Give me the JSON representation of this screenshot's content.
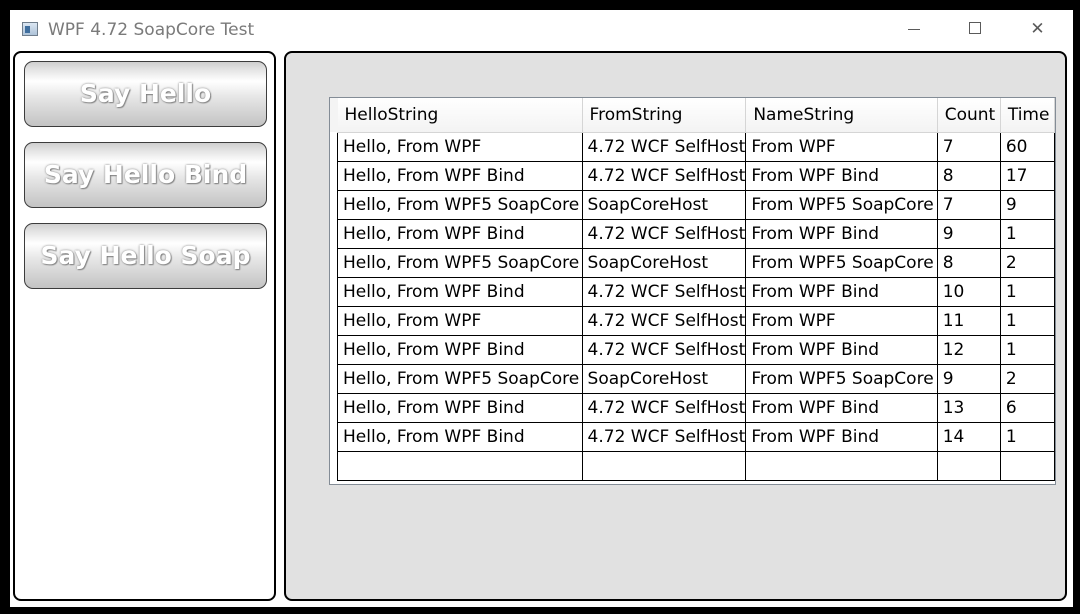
{
  "window": {
    "title": "WPF 4.72 SoapCore Test"
  },
  "buttons": {
    "say_hello": "Say Hello",
    "say_hello_bind": "Say Hello Bind",
    "say_hello_soap": "Say Hello Soap"
  },
  "grid": {
    "columns": [
      "HelloString",
      "FromString",
      "NameString",
      "Count",
      "Time"
    ],
    "rows": [
      [
        "Hello, From WPF",
        "4.72 WCF SelfHost",
        "From WPF",
        "7",
        "60"
      ],
      [
        "Hello, From WPF Bind",
        "4.72 WCF SelfHost",
        "From WPF Bind",
        "8",
        "17"
      ],
      [
        "Hello, From WPF5 SoapCore",
        "SoapCoreHost",
        "From WPF5 SoapCore",
        "7",
        "9"
      ],
      [
        "Hello, From WPF Bind",
        "4.72 WCF SelfHost",
        "From WPF Bind",
        "9",
        "1"
      ],
      [
        "Hello, From WPF5 SoapCore",
        "SoapCoreHost",
        "From WPF5 SoapCore",
        "8",
        "2"
      ],
      [
        "Hello, From WPF Bind",
        "4.72 WCF SelfHost",
        "From WPF Bind",
        "10",
        "1"
      ],
      [
        "Hello, From WPF",
        "4.72 WCF SelfHost",
        "From WPF",
        "11",
        "1"
      ],
      [
        "Hello, From WPF Bind",
        "4.72 WCF SelfHost",
        "From WPF Bind",
        "12",
        "1"
      ],
      [
        "Hello, From WPF5 SoapCore",
        "SoapCoreHost",
        "From WPF5 SoapCore",
        "9",
        "2"
      ],
      [
        "Hello, From WPF Bind",
        "4.72 WCF SelfHost",
        "From WPF Bind",
        "13",
        "6"
      ],
      [
        "Hello, From WPF Bind",
        "4.72 WCF SelfHost",
        "From WPF Bind",
        "14",
        "1"
      ]
    ]
  },
  "icons": {
    "app": "window-app-icon",
    "minimize": "minimize-icon",
    "maximize": "maximize-icon",
    "close": "close-icon"
  },
  "colors": {
    "panel_background": "#e1e1e1",
    "border": "#000000",
    "title_text": "#7a7a7a"
  }
}
